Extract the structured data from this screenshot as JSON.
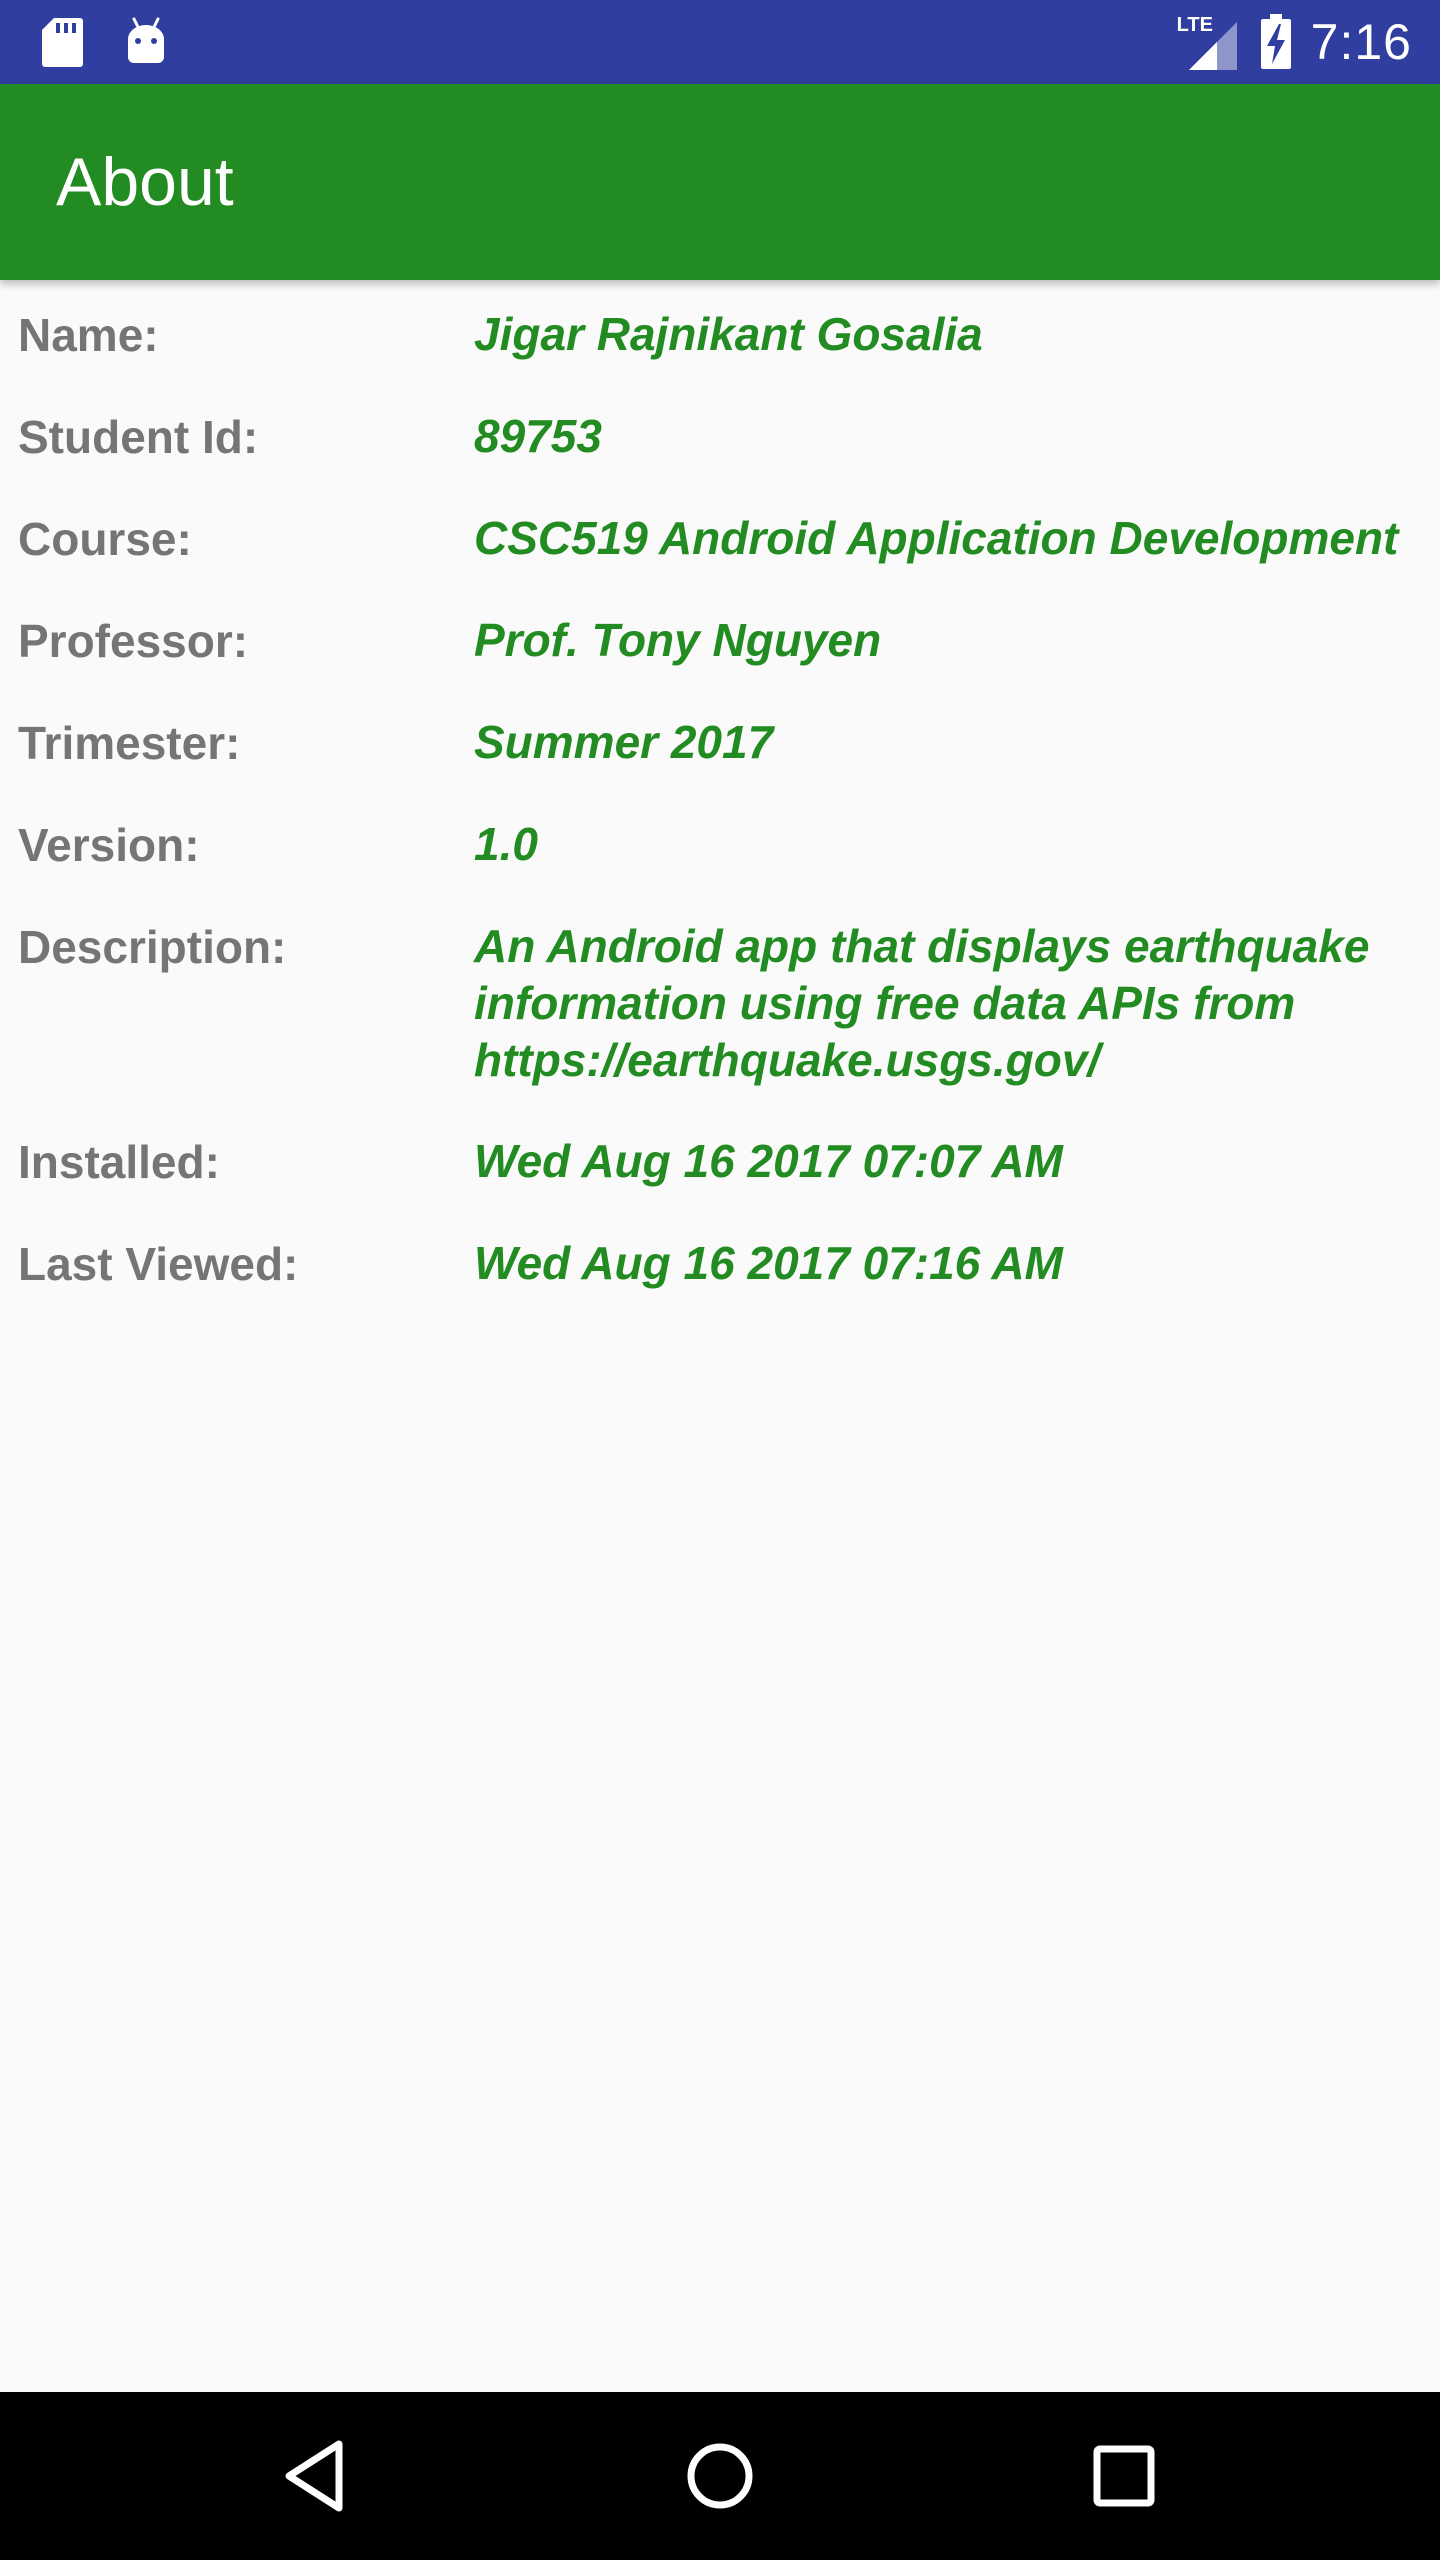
{
  "status_bar": {
    "left_icons": [
      "sd-card-icon",
      "android-icon"
    ],
    "network_label": "LTE",
    "time": "7:16"
  },
  "app_bar": {
    "title": "About"
  },
  "about": {
    "name": {
      "label": "Name:",
      "value": "Jigar Rajnikant Gosalia"
    },
    "student_id": {
      "label": "Student Id:",
      "value": "89753"
    },
    "course": {
      "label": "Course:",
      "value": "CSC519 Android Application Development"
    },
    "professor": {
      "label": "Professor:",
      "value": "Prof. Tony Nguyen"
    },
    "trimester": {
      "label": "Trimester:",
      "value": "Summer 2017"
    },
    "version": {
      "label": "Version:",
      "value": "1.0"
    },
    "description": {
      "label": "Description:",
      "value": "An Android app that displays earthquake information using free data APIs from https://earthquake.usgs.gov/"
    },
    "installed": {
      "label": "Installed:",
      "value": "Wed Aug 16 2017 07:07 AM"
    },
    "last_viewed": {
      "label": "Last Viewed:",
      "value": "Wed Aug 16 2017 07:16 AM"
    }
  },
  "nav_bar": {
    "buttons": [
      "back-icon",
      "home-icon",
      "recents-icon"
    ]
  },
  "colors": {
    "status_bar": "#303f9f",
    "app_bar": "#228b22",
    "label_text": "#757575",
    "value_text": "#228b22",
    "background": "#fafafa",
    "nav_bar": "#000000"
  }
}
